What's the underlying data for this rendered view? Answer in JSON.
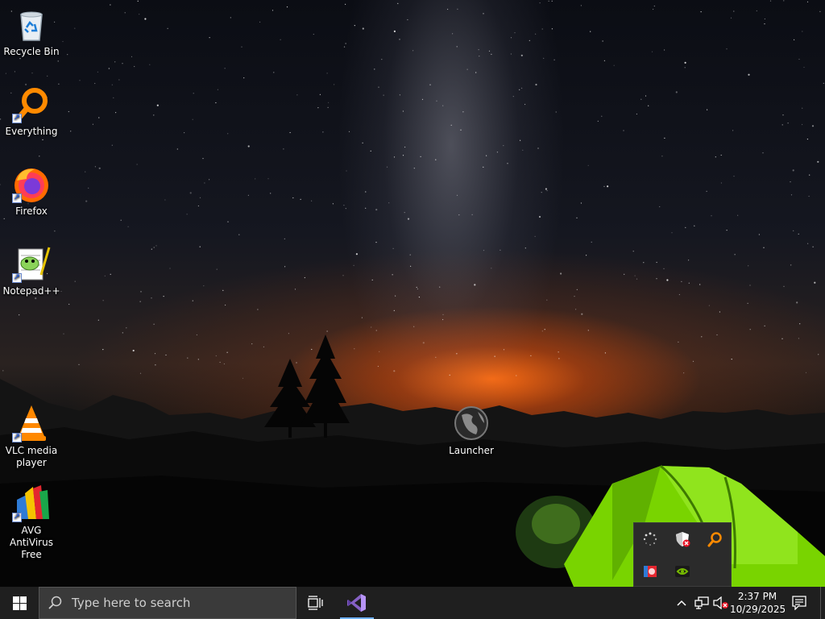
{
  "desktop": {
    "icons": [
      {
        "label": "Recycle Bin",
        "icon": "recycle-bin-icon"
      },
      {
        "label": "Everything",
        "icon": "everything-search-icon"
      },
      {
        "label": "Firefox",
        "icon": "firefox-icon"
      },
      {
        "label": "Notepad++",
        "icon": "notepadpp-icon"
      },
      {
        "label": "VLC media player",
        "icon": "vlc-icon"
      },
      {
        "label": "AVG AntiVirus Free",
        "icon": "avg-icon"
      },
      {
        "label": "Launcher",
        "icon": "launcher-globe-icon"
      }
    ]
  },
  "tray_overflow": {
    "icons": [
      "loading-spinner-icon",
      "security-shield-alert-icon",
      "everything-tray-icon",
      "avg-tray-icon",
      "nvidia-icon"
    ]
  },
  "taskbar": {
    "search_placeholder": "Type here to search",
    "pinned": [
      "task-view-icon",
      "visual-studio-icon"
    ],
    "clock": {
      "time": "2:37 PM",
      "date": "10/29/2025"
    }
  },
  "colors": {
    "taskbar_bg": "#1f1f1f",
    "search_bg": "#3a3a3a",
    "accent": "#6fb2ff",
    "tent_green": "#7ee000"
  }
}
